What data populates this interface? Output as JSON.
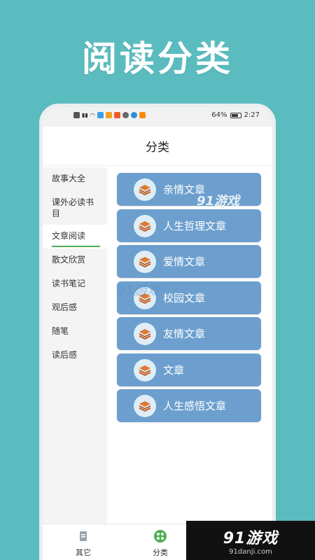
{
  "promo": {
    "title": "阅读分类"
  },
  "status_bar": {
    "battery": "64%",
    "time": "2:27"
  },
  "header": {
    "title": "分类"
  },
  "sidebar": {
    "items": [
      {
        "label": "故事大全"
      },
      {
        "label": "课外必读书目"
      },
      {
        "label": "文章阅读",
        "active": true
      },
      {
        "label": "散文欣赏"
      },
      {
        "label": "读书笔记"
      },
      {
        "label": "观后感"
      },
      {
        "label": "随笔"
      },
      {
        "label": "读后感"
      }
    ]
  },
  "categories": [
    {
      "label": "亲情文章",
      "icon": "layers-icon"
    },
    {
      "label": "人生哲理文章",
      "icon": "layers-icon"
    },
    {
      "label": "爱情文章",
      "icon": "layers-icon"
    },
    {
      "label": "校园文章",
      "icon": "layers-icon"
    },
    {
      "label": "友情文章",
      "icon": "layers-icon"
    },
    {
      "label": "文章",
      "icon": "layers-icon"
    },
    {
      "label": "人生感悟文章",
      "icon": "layers-icon"
    }
  ],
  "tabbar": {
    "tabs": [
      {
        "label": "其它",
        "icon": "document-icon"
      },
      {
        "label": "分类",
        "icon": "grid-icon",
        "active": true
      }
    ]
  },
  "watermark": {
    "brand": "91游戏",
    "url": "91danji.com"
  },
  "colors": {
    "background": "#5bbcbf",
    "card": "#6c9fce",
    "active_underline": "#4caf50"
  }
}
